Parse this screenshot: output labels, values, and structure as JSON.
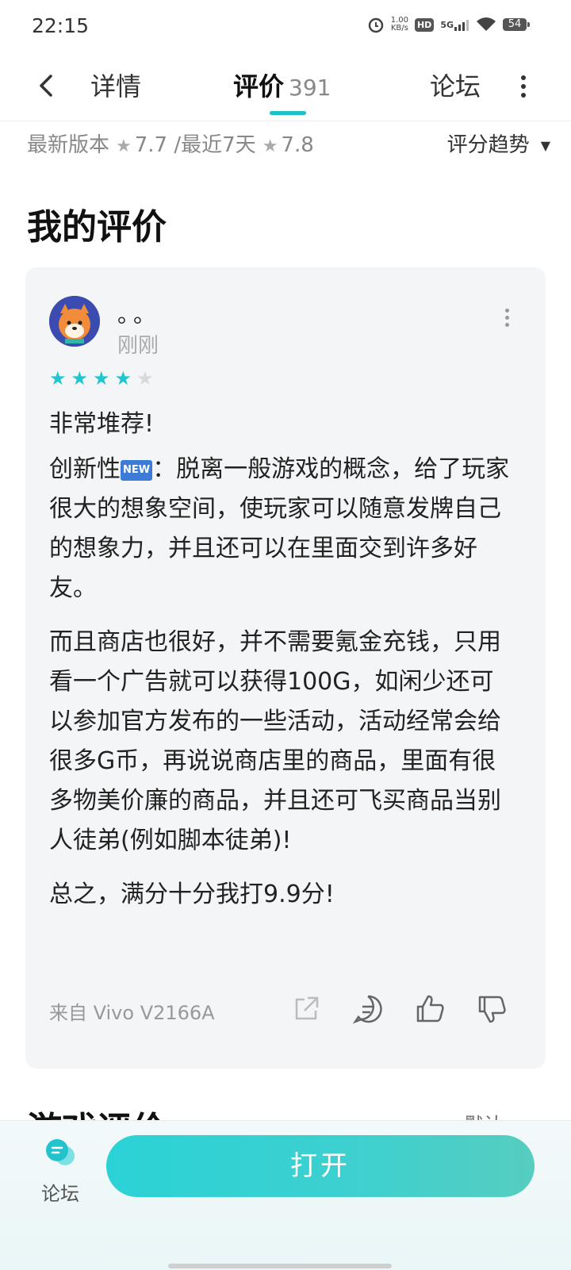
{
  "status": {
    "time": "22:15",
    "speed_value": "1.00",
    "speed_unit": "KB/s",
    "hd": "HD",
    "network": "5G",
    "battery": "54"
  },
  "nav": {
    "tab_detail": "详情",
    "tab_reviews": "评价",
    "review_count": "391",
    "tab_forum": "论坛"
  },
  "rating": {
    "latest_label": "最新版本",
    "latest_score": "7.7",
    "separator": "/",
    "recent_label": "最近7天",
    "recent_score": "7.8",
    "trend_label": "评分趋势"
  },
  "my_review": {
    "section_title": "我的评价",
    "username": "。。",
    "time": "刚刚",
    "stars": 4,
    "stars_max": 5,
    "title": "非常堆荐!",
    "p1_before": "创新性",
    "new_badge": "NEW",
    "p1_after": "：脱离一般游戏的概念，给了玩家很大的想象空间，使玩家可以随意发牌自己的想象力，并且还可以在里面交到许多好友。",
    "p2": "而且商店也很好，并不需要氪金充钱，只用看一个广告就可以获得100G，如闲少还可以参加官方发布的一些活动，活动经常会给很多G币，再说说商店里的商品，里面有很多物美价廉的商品，并且还可飞买商品当别人徒弟(例如脚本徒弟)!",
    "p3": "总之，满分十分我打9.9分!",
    "device": "来自 Vivo V2166A"
  },
  "next_section": {
    "title": "游戏评价",
    "sort": "默认"
  },
  "bottom": {
    "forum_label": "论坛",
    "open_button": "打开"
  },
  "colors": {
    "accent": "#1dbfc8",
    "star_on": "#1fc6cf",
    "button_gradient_start": "#2ad2d6",
    "button_gradient_end": "#56cdbf"
  }
}
